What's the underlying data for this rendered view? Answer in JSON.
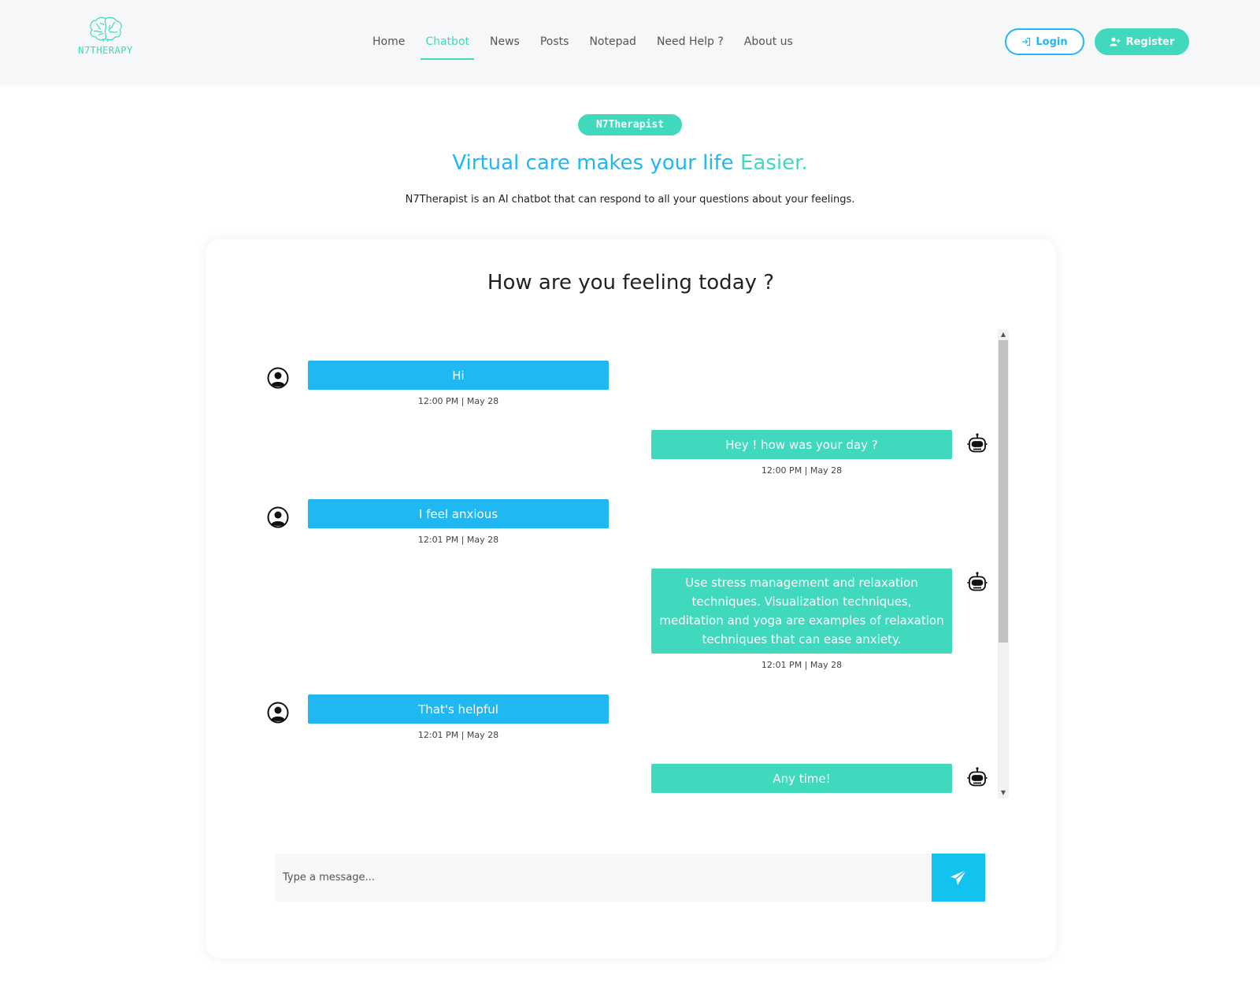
{
  "brand": {
    "name": "N7THERAPY",
    "logo_icon": "brain-icon"
  },
  "nav": {
    "items": [
      {
        "label": "Home"
      },
      {
        "label": "Chatbot",
        "active": true
      },
      {
        "label": "News"
      },
      {
        "label": "Posts"
      },
      {
        "label": "Notepad"
      },
      {
        "label": "Need Help ?"
      },
      {
        "label": "About us"
      }
    ],
    "login_label": "Login",
    "register_label": "Register"
  },
  "hero": {
    "badge": "N7Therapist",
    "title_main": "Virtual care makes your life ",
    "title_accent": "Easier.",
    "subtitle": "N7Therapist is an AI chatbot that can respond to all your questions about your feelings."
  },
  "chat": {
    "heading": "How are you feeling today ?",
    "messages": [
      {
        "sender": "user",
        "text": "Hi",
        "time": "12:00 PM | May 28"
      },
      {
        "sender": "bot",
        "text": "Hey ! how was your day ?",
        "time": "12:00 PM | May 28"
      },
      {
        "sender": "user",
        "text": "I feel anxious",
        "time": "12:01 PM | May 28"
      },
      {
        "sender": "bot",
        "text": "Use stress management and relaxation techniques. Visualization techniques, meditation and yoga are examples of relaxation techniques that can ease anxiety.",
        "time": "12:01 PM | May 28"
      },
      {
        "sender": "user",
        "text": "That's helpful",
        "time": "12:01 PM | May 28"
      },
      {
        "sender": "bot",
        "text": "Any time!",
        "time": ""
      }
    ],
    "input_placeholder": "Type a message...",
    "input_value": ""
  },
  "colors": {
    "teal": "#40d9be",
    "blue": "#1fb8f3",
    "send": "#12c3f0"
  }
}
